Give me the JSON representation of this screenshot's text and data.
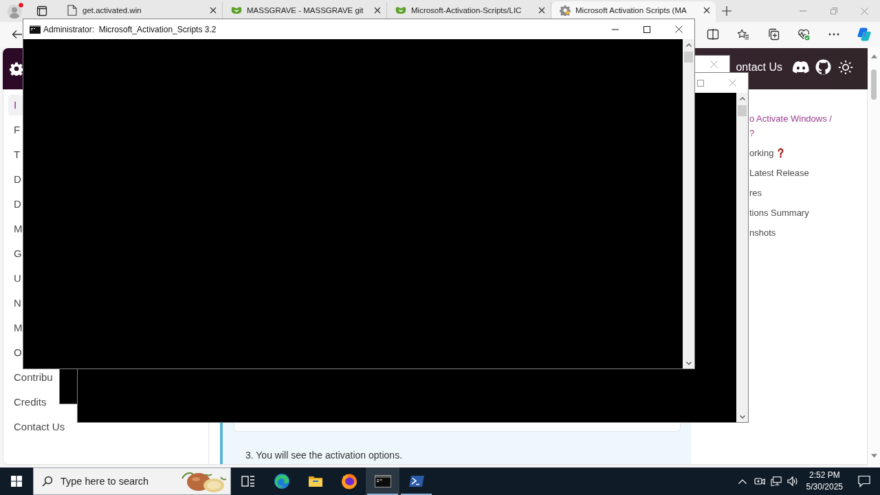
{
  "browser": {
    "tabs": [
      {
        "kind": "page",
        "title": "get.activated.win",
        "selected": false
      },
      {
        "kind": "massgrave",
        "title": "MASSGRAVE - MASSGRAVE git",
        "selected": false
      },
      {
        "kind": "massgrave",
        "title": "Microsoft-Activation-Scripts/LIC",
        "selected": false
      },
      {
        "kind": "gear",
        "title": "Microsoft Activation Scripts (MA",
        "selected": true
      }
    ]
  },
  "console_window": {
    "title": "Administrator:  Microsoft_Activation_Scripts 3.2"
  },
  "site": {
    "header_link": "ontact Us",
    "nav": [
      {
        "label": "I",
        "selected": true
      },
      {
        "label": "F",
        "selected": false
      },
      {
        "label": "T",
        "selected": false
      },
      {
        "label": "D",
        "selected": false
      },
      {
        "label": "D",
        "selected": false
      },
      {
        "label": "M",
        "selected": false
      },
      {
        "label": "G",
        "selected": false
      },
      {
        "label": "U",
        "selected": false
      },
      {
        "label": "N",
        "selected": false
      },
      {
        "label": "M",
        "selected": false
      },
      {
        "label": "O",
        "selected": false
      },
      {
        "label": "Contribu",
        "selected": false
      },
      {
        "label": "Credits",
        "selected": false
      },
      {
        "label": "Contact Us",
        "selected": false
      }
    ],
    "toc": [
      {
        "kind": "plain",
        "lines": [
          "o Activate Windows /",
          "?"
        ],
        "selected": true
      },
      {
        "kind": "question",
        "lines": [
          "orking"
        ],
        "selected": false
      },
      {
        "kind": "plain",
        "lines": [
          "Latest Release"
        ],
        "selected": false
      },
      {
        "kind": "plain",
        "lines": [
          "res"
        ],
        "selected": false
      },
      {
        "kind": "plain",
        "lines": [
          "tions Summary"
        ],
        "selected": false
      },
      {
        "kind": "plain",
        "lines": [
          "nshots"
        ],
        "selected": false
      }
    ],
    "callout": {
      "text": "3. You will see the activation options."
    }
  },
  "taskbar": {
    "search": {
      "placeholder": "Type here to search"
    },
    "apps": [
      {
        "kind": "task-view",
        "running": false,
        "selected": false
      },
      {
        "kind": "edge",
        "running": false,
        "selected": false
      },
      {
        "kind": "explorer",
        "running": false,
        "selected": false
      },
      {
        "kind": "firefox",
        "running": false,
        "selected": false
      },
      {
        "kind": "console",
        "running": true,
        "selected": true
      },
      {
        "kind": "powershell",
        "running": true,
        "selected": false
      }
    ],
    "clock": {
      "time": "2:52 PM",
      "date": "5/30/2025"
    }
  }
}
